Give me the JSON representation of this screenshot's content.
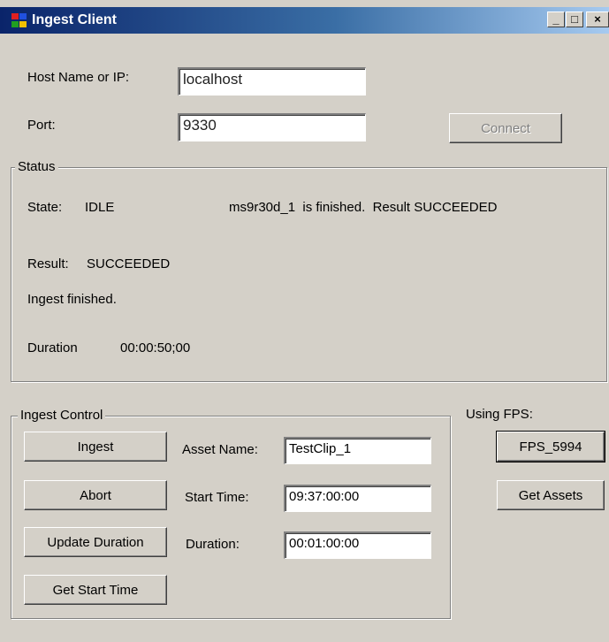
{
  "window": {
    "title": "Ingest Client",
    "controls": {
      "minimize": "_",
      "maximize": "□",
      "close": "×"
    }
  },
  "connection": {
    "host_label": "Host Name or IP:",
    "host_value": "localhost",
    "port_label": "Port:",
    "port_value": "9330",
    "connect_label": "Connect"
  },
  "status": {
    "group_label": "Status",
    "state_label": "State:",
    "state_value": "IDLE",
    "message": "ms9r30d_1  is finished.  Result SUCCEEDED",
    "result_label": "Result:",
    "result_value": "SUCCEEDED",
    "info": "Ingest finished.",
    "duration_label": "Duration",
    "duration_value": "00:00:50;00"
  },
  "ingest_control": {
    "group_label": "Ingest Control",
    "ingest_label": "Ingest",
    "abort_label": "Abort",
    "update_duration_label": "Update Duration",
    "get_start_time_label": "Get Start Time",
    "asset_name_label": "Asset Name:",
    "asset_name_value": "TestClip_1",
    "start_time_label": "Start Time:",
    "start_time_value": "09:37:00:00",
    "duration_label": "Duration:",
    "duration_value": "00:01:00:00"
  },
  "fps": {
    "label": "Using FPS:",
    "fps_button_label": "FPS_5994",
    "get_assets_label": "Get Assets"
  },
  "colors": {
    "face": "#d4d0c8",
    "titlebar_start": "#0a246a",
    "titlebar_end": "#a6caf0"
  }
}
